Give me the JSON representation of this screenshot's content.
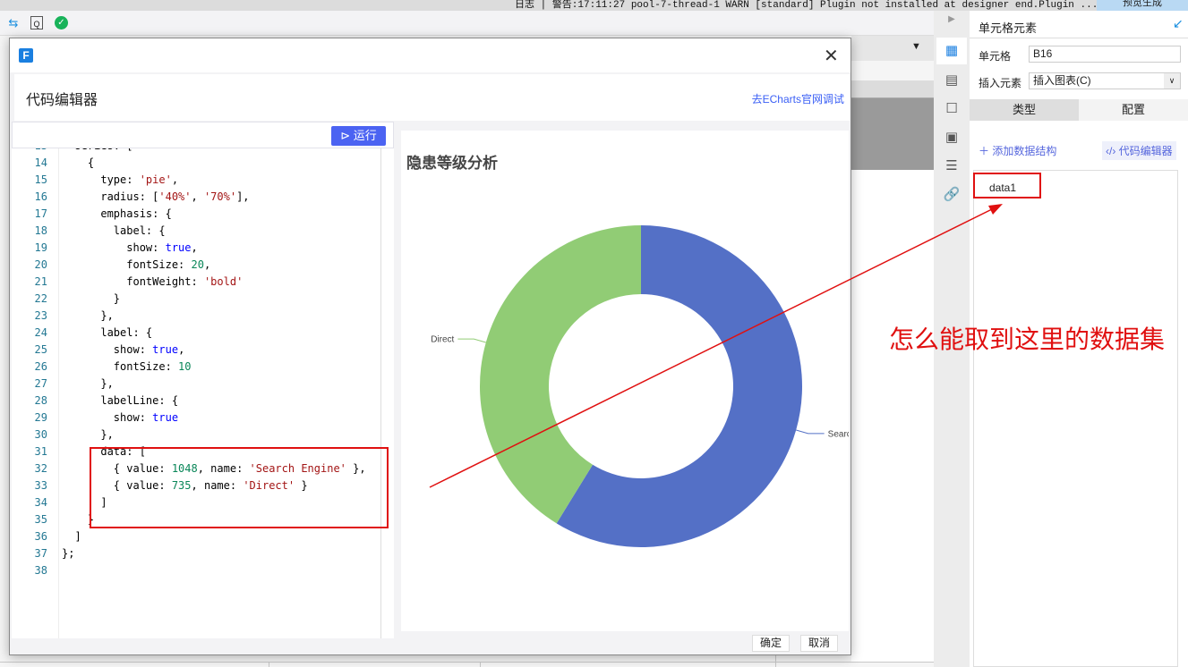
{
  "topbar": {
    "log": "日志 | 警告:17:11:27 pool-7-thread-1 WARN [standard] Plugin not installed at designer end.Plugin ...",
    "publish": "预览生成"
  },
  "dialog": {
    "title": "代码编辑器",
    "echarts_link": "去ECharts官网调试",
    "run_label": "运行",
    "ok_label": "确定",
    "cancel_label": "取消",
    "code_lines": [
      {
        "num": "13",
        "tokens": [
          [
            "k",
            "  series: ["
          ]
        ]
      },
      {
        "num": "14",
        "tokens": [
          [
            "k",
            "    {"
          ]
        ]
      },
      {
        "num": "15",
        "tokens": [
          [
            "k",
            "      type: "
          ],
          [
            "s",
            "'pie'"
          ],
          [
            "k",
            ","
          ]
        ]
      },
      {
        "num": "16",
        "tokens": [
          [
            "k",
            "      radius: ["
          ],
          [
            "s",
            "'40%'"
          ],
          [
            "k",
            ", "
          ],
          [
            "s",
            "'70%'"
          ],
          [
            "k",
            "],"
          ]
        ]
      },
      {
        "num": "17",
        "tokens": [
          [
            "k",
            "      emphasis: {"
          ]
        ]
      },
      {
        "num": "18",
        "tokens": [
          [
            "k",
            "        label: {"
          ]
        ]
      },
      {
        "num": "19",
        "tokens": [
          [
            "k",
            "          show: "
          ],
          [
            "b",
            "true"
          ],
          [
            "k",
            ","
          ]
        ]
      },
      {
        "num": "20",
        "tokens": [
          [
            "k",
            "          fontSize: "
          ],
          [
            "n",
            "20"
          ],
          [
            "k",
            ","
          ]
        ]
      },
      {
        "num": "21",
        "tokens": [
          [
            "k",
            "          fontWeight: "
          ],
          [
            "s",
            "'bold'"
          ]
        ]
      },
      {
        "num": "22",
        "tokens": [
          [
            "k",
            "        }"
          ]
        ]
      },
      {
        "num": "23",
        "tokens": [
          [
            "k",
            "      },"
          ]
        ]
      },
      {
        "num": "24",
        "tokens": [
          [
            "k",
            "      label: {"
          ]
        ]
      },
      {
        "num": "25",
        "tokens": [
          [
            "k",
            "        show: "
          ],
          [
            "b",
            "true"
          ],
          [
            "k",
            ","
          ]
        ]
      },
      {
        "num": "26",
        "tokens": [
          [
            "k",
            "        fontSize: "
          ],
          [
            "n",
            "10"
          ]
        ]
      },
      {
        "num": "27",
        "tokens": [
          [
            "k",
            "      },"
          ]
        ]
      },
      {
        "num": "28",
        "tokens": [
          [
            "k",
            "      labelLine: {"
          ]
        ]
      },
      {
        "num": "29",
        "tokens": [
          [
            "k",
            "        show: "
          ],
          [
            "b",
            "true"
          ]
        ]
      },
      {
        "num": "30",
        "tokens": [
          [
            "k",
            "      },"
          ]
        ]
      },
      {
        "num": "31",
        "tokens": [
          [
            "k",
            "      data: ["
          ]
        ]
      },
      {
        "num": "32",
        "tokens": [
          [
            "k",
            "        { value: "
          ],
          [
            "n",
            "1048"
          ],
          [
            "k",
            ", name: "
          ],
          [
            "s",
            "'Search Engine'"
          ],
          [
            "k",
            " },"
          ]
        ]
      },
      {
        "num": "33",
        "tokens": [
          [
            "k",
            "        { value: "
          ],
          [
            "n",
            "735"
          ],
          [
            "k",
            ", name: "
          ],
          [
            "s",
            "'Direct'"
          ],
          [
            "k",
            " }"
          ]
        ]
      },
      {
        "num": "34",
        "tokens": [
          [
            "k",
            "      ]"
          ]
        ]
      },
      {
        "num": "35",
        "tokens": [
          [
            "k",
            "    }"
          ]
        ]
      },
      {
        "num": "36",
        "tokens": [
          [
            "k",
            "  ]"
          ]
        ]
      },
      {
        "num": "37",
        "tokens": [
          [
            "k",
            "};"
          ]
        ]
      },
      {
        "num": "38",
        "tokens": [
          [
            "k",
            ""
          ]
        ]
      }
    ]
  },
  "chart_data": {
    "type": "pie",
    "title": "隐患等级分析",
    "radius": [
      "40%",
      "70%"
    ],
    "slices": [
      {
        "name": "Search Engine",
        "label": "Searc...",
        "value": 1048,
        "color": "#5470c6"
      },
      {
        "name": "Direct",
        "label": "Direct",
        "value": 735,
        "color": "#91cc75"
      }
    ]
  },
  "right_panel": {
    "header": "单元格元素",
    "cell_label": "单元格",
    "cell_value": "B16",
    "insert_label": "插入元素",
    "insert_value": "插入图表(C)",
    "tabs": [
      "类型",
      "配置"
    ],
    "add_data": "添加数据结构",
    "code_editor": "代码编辑器",
    "datasets": [
      "data1"
    ]
  },
  "annotation": {
    "text": "怎么能取到这里的数据集",
    "color": "#e01010"
  }
}
